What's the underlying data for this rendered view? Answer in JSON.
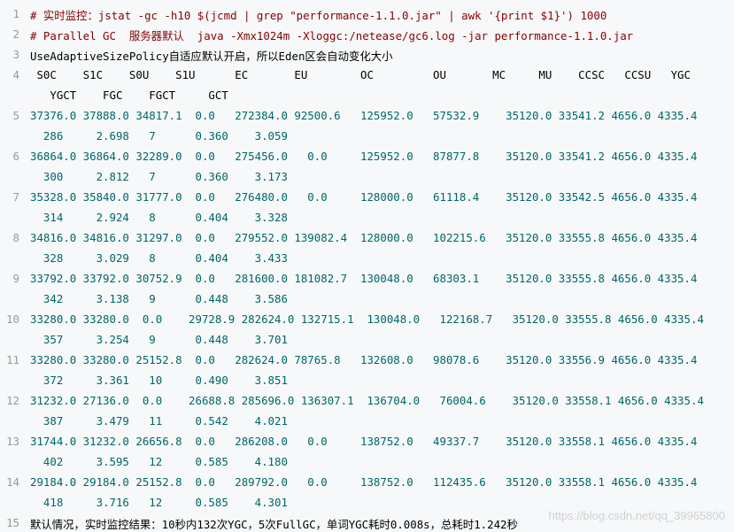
{
  "line_numbers": [
    "1",
    "2",
    "3",
    "4",
    "5",
    "6",
    "7",
    "8",
    "9",
    "10",
    "11",
    "12",
    "13",
    "14",
    "15"
  ],
  "comment1": "# 实时监控：jstat -gc -h10 $(jcmd | grep \"performance-1.1.0.jar\" | awk '{print $1}') 1000",
  "comment2": "# Parallel GC  服务器默认  java -Xmx1024m -Xloggc:/netease/gc6.log -jar performance-1.1.0.jar",
  "line3": "UseAdaptiveSizePolicy自适应默认开启，所以Eden区会自动变化大小",
  "header1": " S0C    S1C    S0U    S1U      EC       EU        OC         OU       MC     MU    CCSC   CCSU   YGC",
  "header2": "   YGCT    FGC    FGCT     GCT",
  "rows": [
    {
      "a": "37376.0 37888.0 34817.1  0.0   272384.0 92500.6   125952.0   57532.9    35120.0 33541.2 4656.0 4335.4",
      "b": "  286     2.698   7      0.360    3.059"
    },
    {
      "a": "36864.0 36864.0 32289.0  0.0   275456.0   0.0     125952.0   87877.8    35120.0 33541.2 4656.0 4335.4",
      "b": "  300     2.812   7      0.360    3.173"
    },
    {
      "a": "35328.0 35840.0 31777.0  0.0   276480.0   0.0     128000.0   61118.4    35120.0 33542.5 4656.0 4335.4",
      "b": "  314     2.924   8      0.404    3.328"
    },
    {
      "a": "34816.0 34816.0 31297.0  0.0   279552.0 139082.4  128000.0   102215.6   35120.0 33555.8 4656.0 4335.4",
      "b": "  328     3.029   8      0.404    3.433"
    },
    {
      "a": "33792.0 33792.0 30752.9  0.0   281600.0 181082.7  130048.0   68303.1    35120.0 33555.8 4656.0 4335.4",
      "b": "  342     3.138   9      0.448    3.586"
    },
    {
      "a": "33280.0 33280.0  0.0    29728.9 282624.0 132715.1  130048.0   122168.7   35120.0 33555.8 4656.0 4335.4",
      "b": "  357     3.254   9      0.448    3.701"
    },
    {
      "a": "33280.0 33280.0 25152.8  0.0   282624.0 78765.8   132608.0   98078.6    35120.0 33556.9 4656.0 4335.4",
      "b": "  372     3.361   10     0.490    3.851"
    },
    {
      "a": "31232.0 27136.0  0.0    26688.8 285696.0 136307.1  136704.0   76004.6    35120.0 33558.1 4656.0 4335.4",
      "b": "  387     3.479   11     0.542    4.021"
    },
    {
      "a": "31744.0 31232.0 26656.8  0.0   286208.0   0.0     138752.0   49337.7    35120.0 33558.1 4656.0 4335.4",
      "b": "  402     3.595   12     0.585    4.180"
    },
    {
      "a": "29184.0 29184.0 25152.8  0.0   289792.0   0.0     138752.0   112435.6   35120.0 33558.1 4656.0 4335.4",
      "b": "  418     3.716   12     0.585    4.301"
    }
  ],
  "line15": "默认情况，实时监控结果：10秒内132次YGC，5次FullGC，单词YGC耗时0.008s，总耗时1.242秒",
  "watermark": "https://blog.csdn.net/qq_39965800",
  "colors": {
    "background": "#f6f8fa",
    "comment": "#880000",
    "value": "#006666",
    "line_number": "#999999"
  }
}
